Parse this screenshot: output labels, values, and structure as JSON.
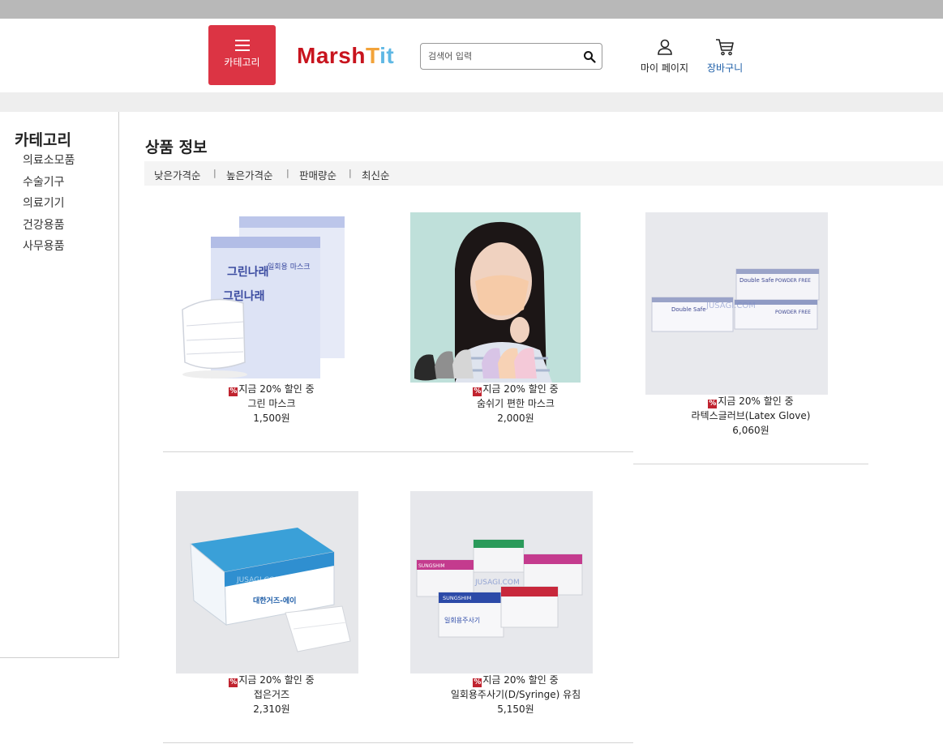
{
  "header": {
    "category_button_label": "카테고리",
    "logo": {
      "part1": "Marsh",
      "part2": "T",
      "part3": "it"
    },
    "search": {
      "placeholder": "검색어 입력",
      "value": ""
    },
    "mypage_label": "마이 페이지",
    "cart_label": "장바구니"
  },
  "sidebar": {
    "title": "카테고리",
    "items": [
      {
        "label": "의료소모품"
      },
      {
        "label": "수술기구"
      },
      {
        "label": "의료기기"
      },
      {
        "label": "건강용품"
      },
      {
        "label": "사무용품"
      }
    ]
  },
  "main": {
    "title": "상품 정보",
    "sort_options": [
      {
        "label": "낮은가격순"
      },
      {
        "label": "높은가격순"
      },
      {
        "label": "판매량순"
      },
      {
        "label": "최신순"
      }
    ],
    "sort_separator": "|"
  },
  "products": [
    {
      "badge": "지금 20% 할인 중",
      "name": "그린 마스크",
      "price": "1,500원",
      "image": "mask-boxes-white"
    },
    {
      "badge": "지금 20% 할인 중",
      "name": "숨쉬기 편한 마스크",
      "price": "2,000원",
      "image": "woman-wearing-mask"
    },
    {
      "badge": "지금 20% 할인 중",
      "name": "라텍스글러브(Latex Glove)",
      "price": "6,060원",
      "image": "glove-boxes"
    },
    {
      "badge": "지금 20% 할인 중",
      "name": "접은거즈",
      "price": "2,310원",
      "image": "gauze-box"
    },
    {
      "badge": "지금 20% 할인 중",
      "name": "일회용주사기(D/Syringe) 유침",
      "price": "5,150원",
      "image": "syringe-boxes"
    }
  ],
  "image_watermark": "JUSAGI.COM",
  "box_texts": {
    "mask_brand": "그린나래",
    "mask_type": "일회용 마스크",
    "glove_brand": "Double Safe",
    "glove_type": "POWDER FREE",
    "gauze_title": "대한거즈-에이",
    "syringe_brand": "SUNGSHIM",
    "syringe_type": "일회용주사기"
  },
  "colors": {
    "brand_red": "#dc3444",
    "logo_red": "#c8141e",
    "logo_orange": "#f2a33a",
    "logo_blue": "#5fb8e4"
  }
}
